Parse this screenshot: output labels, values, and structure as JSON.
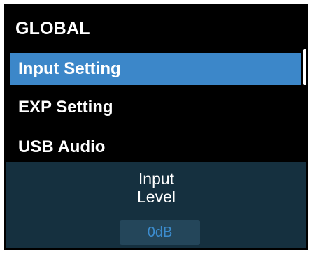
{
  "menu": {
    "title": "GLOBAL",
    "items": [
      {
        "label": "Input Setting",
        "selected": true
      },
      {
        "label": "EXP Setting",
        "selected": false
      },
      {
        "label": "USB Audio",
        "selected": false
      }
    ]
  },
  "parameter": {
    "name_line1": "Input",
    "name_line2": "Level",
    "value": "0dB"
  },
  "colors": {
    "background": "#000000",
    "selected": "#3c87c9",
    "panel": "#15303f",
    "value_box": "#24465a",
    "value_text": "#3c8dcf"
  }
}
